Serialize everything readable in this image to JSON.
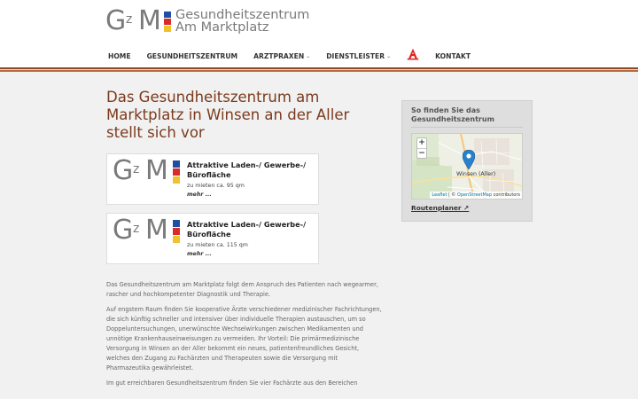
{
  "brand": {
    "logo_letters": [
      "G",
      "z",
      "M"
    ],
    "name_line1": "Gesundheitszentrum",
    "name_line2": "Am Marktplatz",
    "bar_colors": [
      "#1f4fa3",
      "#d62c2c",
      "#f2c12e"
    ]
  },
  "nav": {
    "items": [
      {
        "label": "HOME",
        "has_dropdown": false
      },
      {
        "label": "GESUNDHEITSZENTRUM",
        "has_dropdown": false
      },
      {
        "label": "ARZTPRAXEN",
        "has_dropdown": true
      },
      {
        "label": "DIENSTLEISTER",
        "has_dropdown": true
      },
      {
        "label": "KONTAKT",
        "has_dropdown": false
      }
    ],
    "chevron": "⌄",
    "pharmacy_icon": "apotheke-a-icon",
    "pharmacy_color": "#e2211c"
  },
  "page": {
    "title": "Das Gesundheitszentrum am Marktplatz in Winsen an der Aller stellt sich vor",
    "title_color": "#7b3a1d"
  },
  "cards": [
    {
      "title": "Attraktive Laden-/ Gewerbe-/ Bürofläche",
      "subtitle": "zu mieten ca. 95 qm",
      "more": "mehr ..."
    },
    {
      "title": "Attraktive Laden-/ Gewerbe-/ Bürofläche",
      "subtitle": "zu mieten ca. 115 qm",
      "more": "mehr ..."
    }
  ],
  "content": {
    "paragraphs": [
      "Das Gesundheitszentrum am Marktplatz folgt dem Anspruch des Patienten nach wegearmer, rascher und hochkompetenter Diagnostik und Therapie.",
      "Auf engstem Raum finden Sie kooperative Ärzte verschiedener medizinischer Fachrichtungen, die sich künftig schneller und intensiver über individuelle Therapien austauschen, um so Doppeluntersuchungen, unerwünschte Wechselwirkungen zwischen Medikamenten und unnötige Krankenhauseinweisungen zu vermeiden. Ihr Vorteil: Die primärmedizinische Versorgung in Winsen an der Aller bekommt ein neues, patientenfreundliches Gesicht, welches den Zugang zu Fachärzten und Therapeuten sowie die Versorgung mit Pharmazeutika gewährleistet.",
      "Im gut erreichbaren Gesundheitszentrum finden Sie vier Fachärzte aus den Bereichen"
    ]
  },
  "sidebar": {
    "title": "So finden Sie das Gesundheitszentrum",
    "map": {
      "zoom_in": "+",
      "zoom_out": "−",
      "place_label": "Winsen (Aller)",
      "attribution_leaflet": "Leaflet",
      "attribution_sep": " | © ",
      "attribution_osm": "OpenStreetMap",
      "attribution_rest": " contributors",
      "marker_color": "#2a81cb"
    },
    "route_label": "Routenplaner ↗"
  }
}
